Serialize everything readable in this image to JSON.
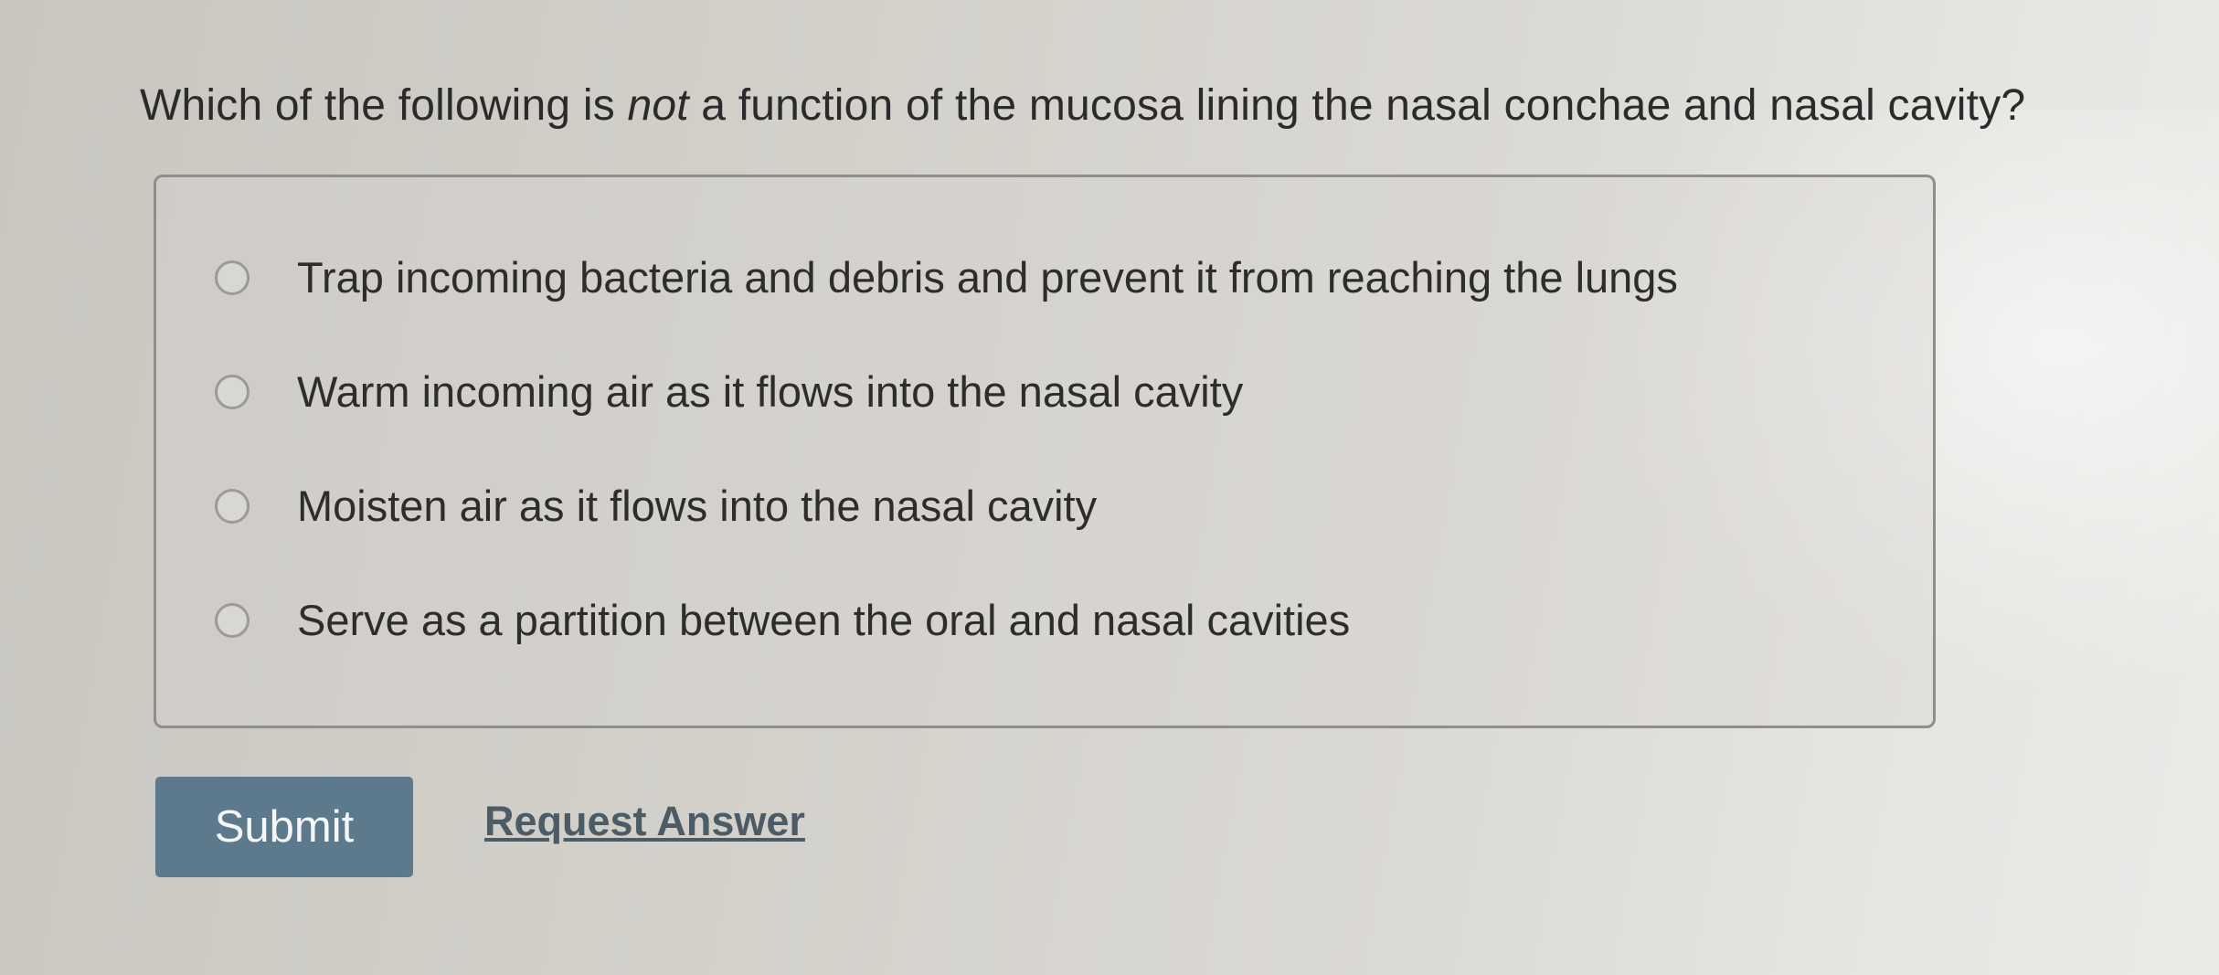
{
  "question": {
    "prefix": "Which of the following is ",
    "emphasis": "not",
    "suffix": " a function of the mucosa lining the nasal conchae and nasal cavity?"
  },
  "options": [
    {
      "label": "Trap incoming bacteria and debris and prevent it from reaching the lungs",
      "selected": false
    },
    {
      "label": "Warm incoming air as it flows into the nasal cavity",
      "selected": false
    },
    {
      "label": "Moisten air as it flows into the nasal cavity",
      "selected": false
    },
    {
      "label": "Serve as a partition between the oral and nasal cavities",
      "selected": false
    }
  ],
  "actions": {
    "submit_label": "Submit",
    "request_answer_label": "Request Answer"
  },
  "colors": {
    "submit_background": "#5c7a8c",
    "link_color": "#4c5c66"
  }
}
